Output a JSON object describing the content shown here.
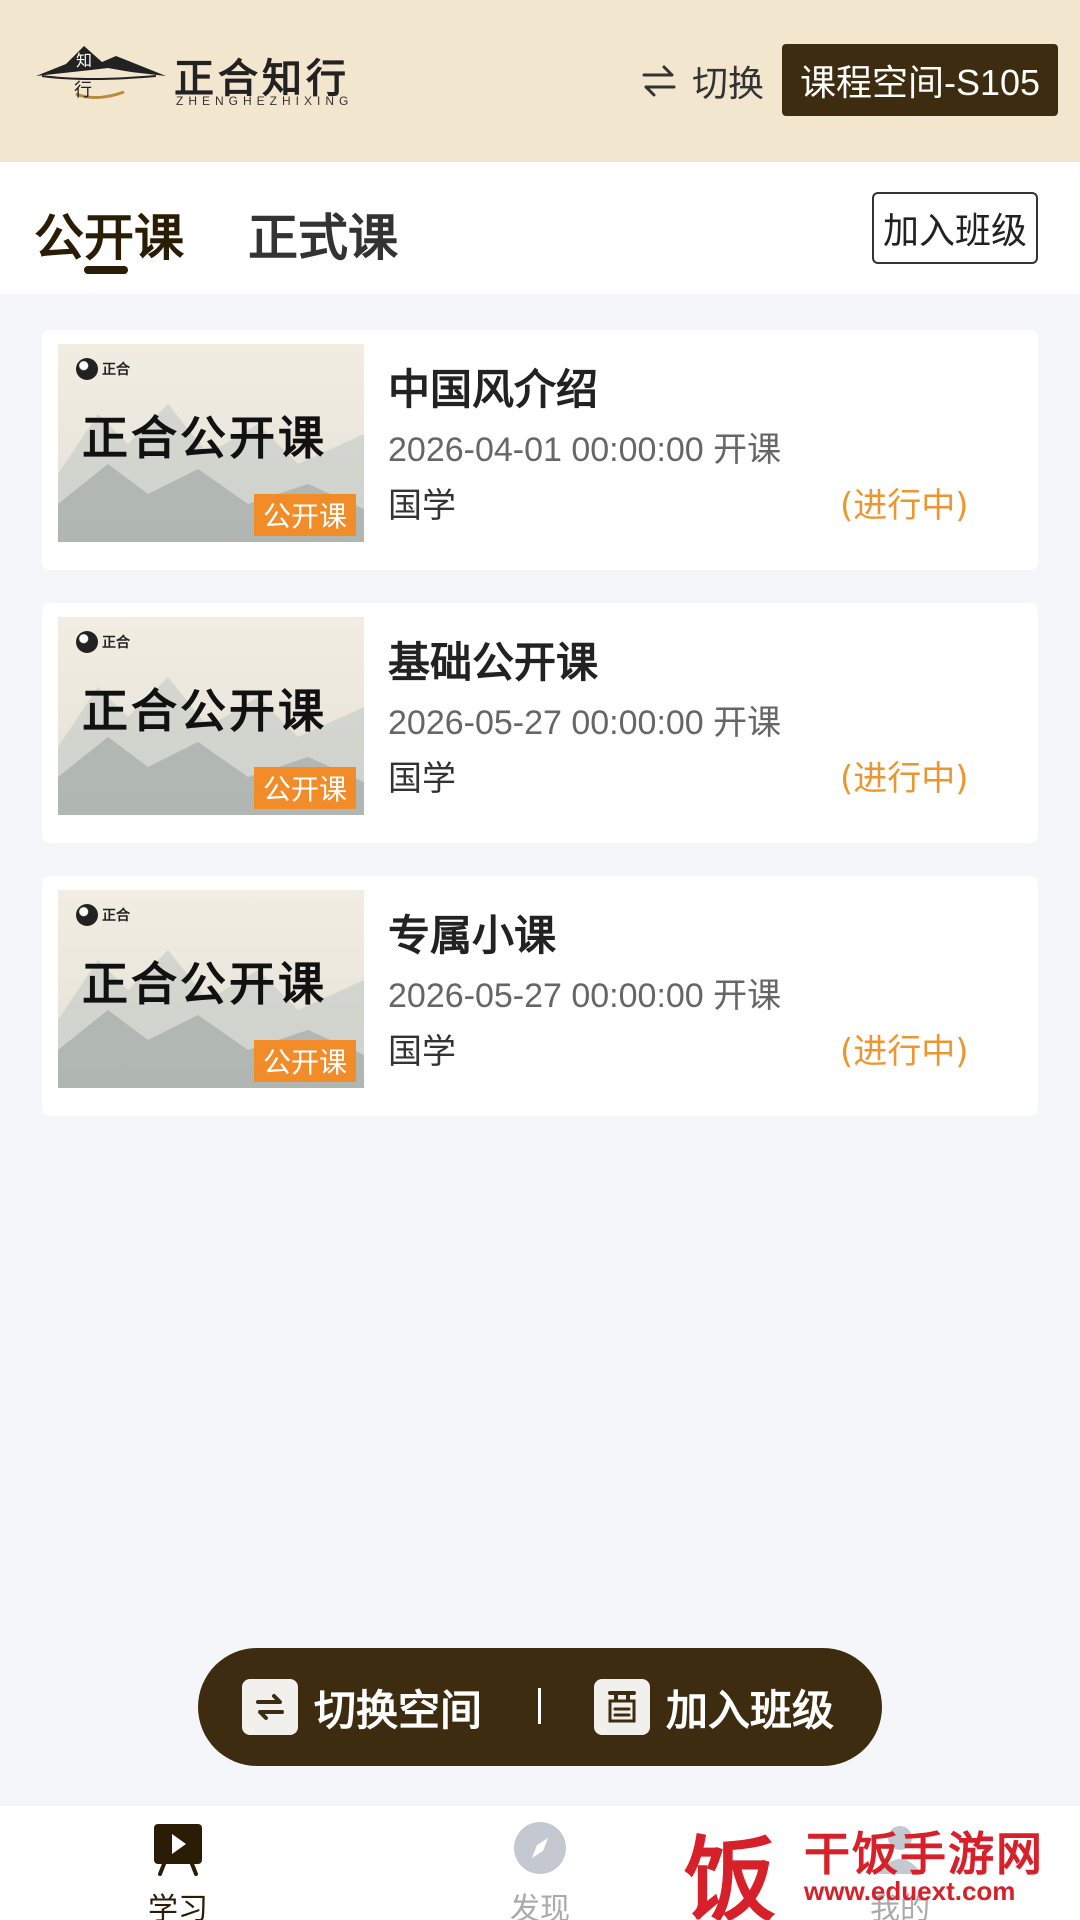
{
  "header": {
    "logo_title": "正合知行",
    "logo_subtitle": "ZHENGHEZHIXING",
    "switch_label": "切换",
    "space_label": "课程空间-S105"
  },
  "tabs": [
    {
      "label": "公开课",
      "active": true
    },
    {
      "label": "正式课",
      "active": false
    }
  ],
  "join_class_label": "加入班级",
  "courses": [
    {
      "thumb_logo": "正合",
      "thumb_title": "正合公开课",
      "thumb_tag": "公开课",
      "title": "中国风介绍",
      "date": "2026-04-01 00:00:00 开课",
      "category": "国学",
      "status": "(进行中)"
    },
    {
      "thumb_logo": "正合",
      "thumb_title": "正合公开课",
      "thumb_tag": "公开课",
      "title": "基础公开课",
      "date": "2026-05-27 00:00:00 开课",
      "category": "国学",
      "status": "(进行中)"
    },
    {
      "thumb_logo": "正合",
      "thumb_title": "正合公开课",
      "thumb_tag": "公开课",
      "title": "专属小课",
      "date": "2026-05-27 00:00:00 开课",
      "category": "国学",
      "status": "(进行中)"
    }
  ],
  "float_bar": {
    "switch_space": "切换空间",
    "join_class": "加入班级"
  },
  "bottom_nav": [
    {
      "label": "学习",
      "icon": "study-icon",
      "active": true
    },
    {
      "label": "发现",
      "icon": "compass-icon",
      "active": false
    },
    {
      "label": "我的",
      "icon": "profile-icon",
      "active": false
    }
  ],
  "watermark": {
    "char": "饭",
    "name": "干饭手游网",
    "url": "www.eduext.com"
  },
  "colors": {
    "header_bg": "#f3e6cf",
    "brand_dark": "#3e2c10",
    "status_orange": "#ec9630",
    "tag_orange": "#f28c28",
    "watermark_red": "#d6202a"
  }
}
